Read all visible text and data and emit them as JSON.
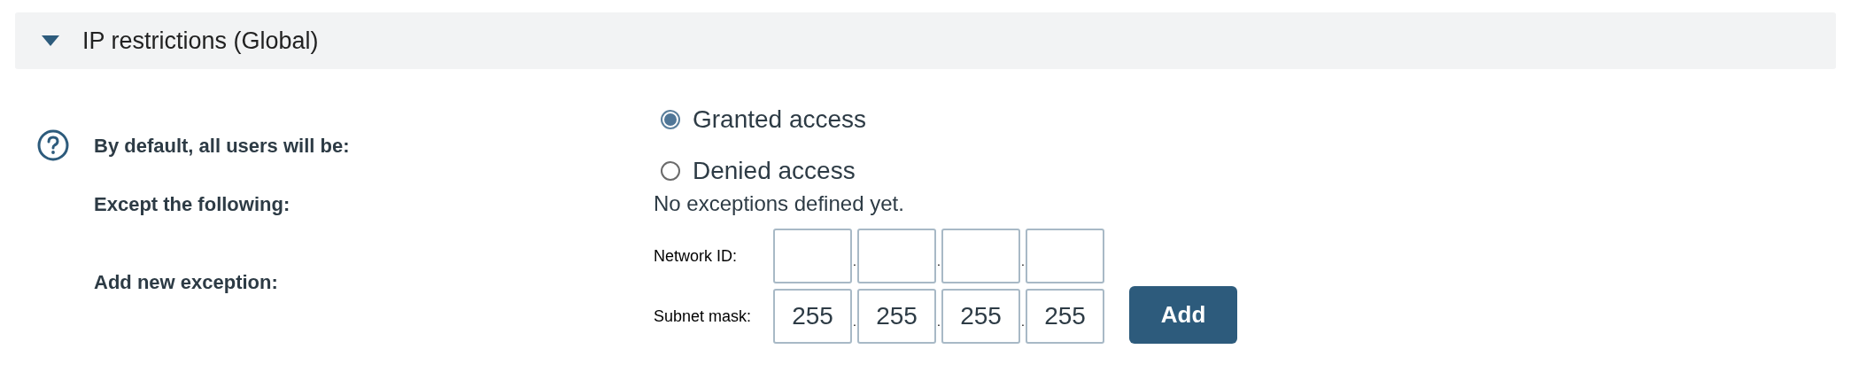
{
  "section": {
    "title": "IP restrictions (Global)",
    "expanded": true
  },
  "default_access": {
    "label": "By default, all users will be:",
    "options": [
      {
        "label": "Granted access",
        "selected": true
      },
      {
        "label": "Denied access",
        "selected": false
      }
    ]
  },
  "exceptions": {
    "label": "Except the following:",
    "message": "No exceptions defined yet."
  },
  "new_exception": {
    "label": "Add new exception:",
    "rows": [
      {
        "label": "Network ID:",
        "separator": ".",
        "octets": [
          {
            "kind": "empty"
          },
          {
            "kind": "empty"
          },
          {
            "kind": "empty"
          },
          {
            "kind": "empty"
          }
        ]
      },
      {
        "label": "Subnet mask:",
        "separator": ".",
        "octets": [
          {
            "kind": "filled",
            "value": "255"
          },
          {
            "kind": "filled",
            "value": "255"
          },
          {
            "kind": "filled",
            "value": "255"
          },
          {
            "kind": "filled",
            "value": "255"
          }
        ]
      }
    ],
    "button": "Add"
  }
}
